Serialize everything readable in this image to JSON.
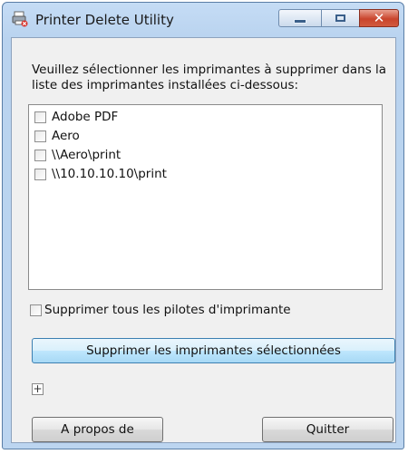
{
  "window": {
    "title": "Printer Delete Utility",
    "icon": "printer-delete-icon",
    "controls": {
      "minimize": "minimize-icon",
      "maximize": "maximize-icon",
      "close": "close-icon"
    }
  },
  "instructions": "Veuillez sélectionner les imprimantes à supprimer dans la liste des imprimantes installées ci-dessous:",
  "printers": [
    {
      "label": "Adobe PDF",
      "checked": false
    },
    {
      "label": "Aero",
      "checked": false
    },
    {
      "label": "\\\\Aero\\print",
      "checked": false
    },
    {
      "label": "\\\\10.10.10.10\\print",
      "checked": false
    }
  ],
  "delete_all_drivers": {
    "label": "Supprimer tous les pilotes d'imprimante",
    "checked": false
  },
  "buttons": {
    "delete_selected": "Supprimer les imprimantes sélectionnées",
    "about": "A propos de",
    "quit": "Quitter"
  },
  "expand_toggle": "+",
  "colors": {
    "close_button": "#c9442c",
    "focus_border": "#3c7fb1"
  }
}
